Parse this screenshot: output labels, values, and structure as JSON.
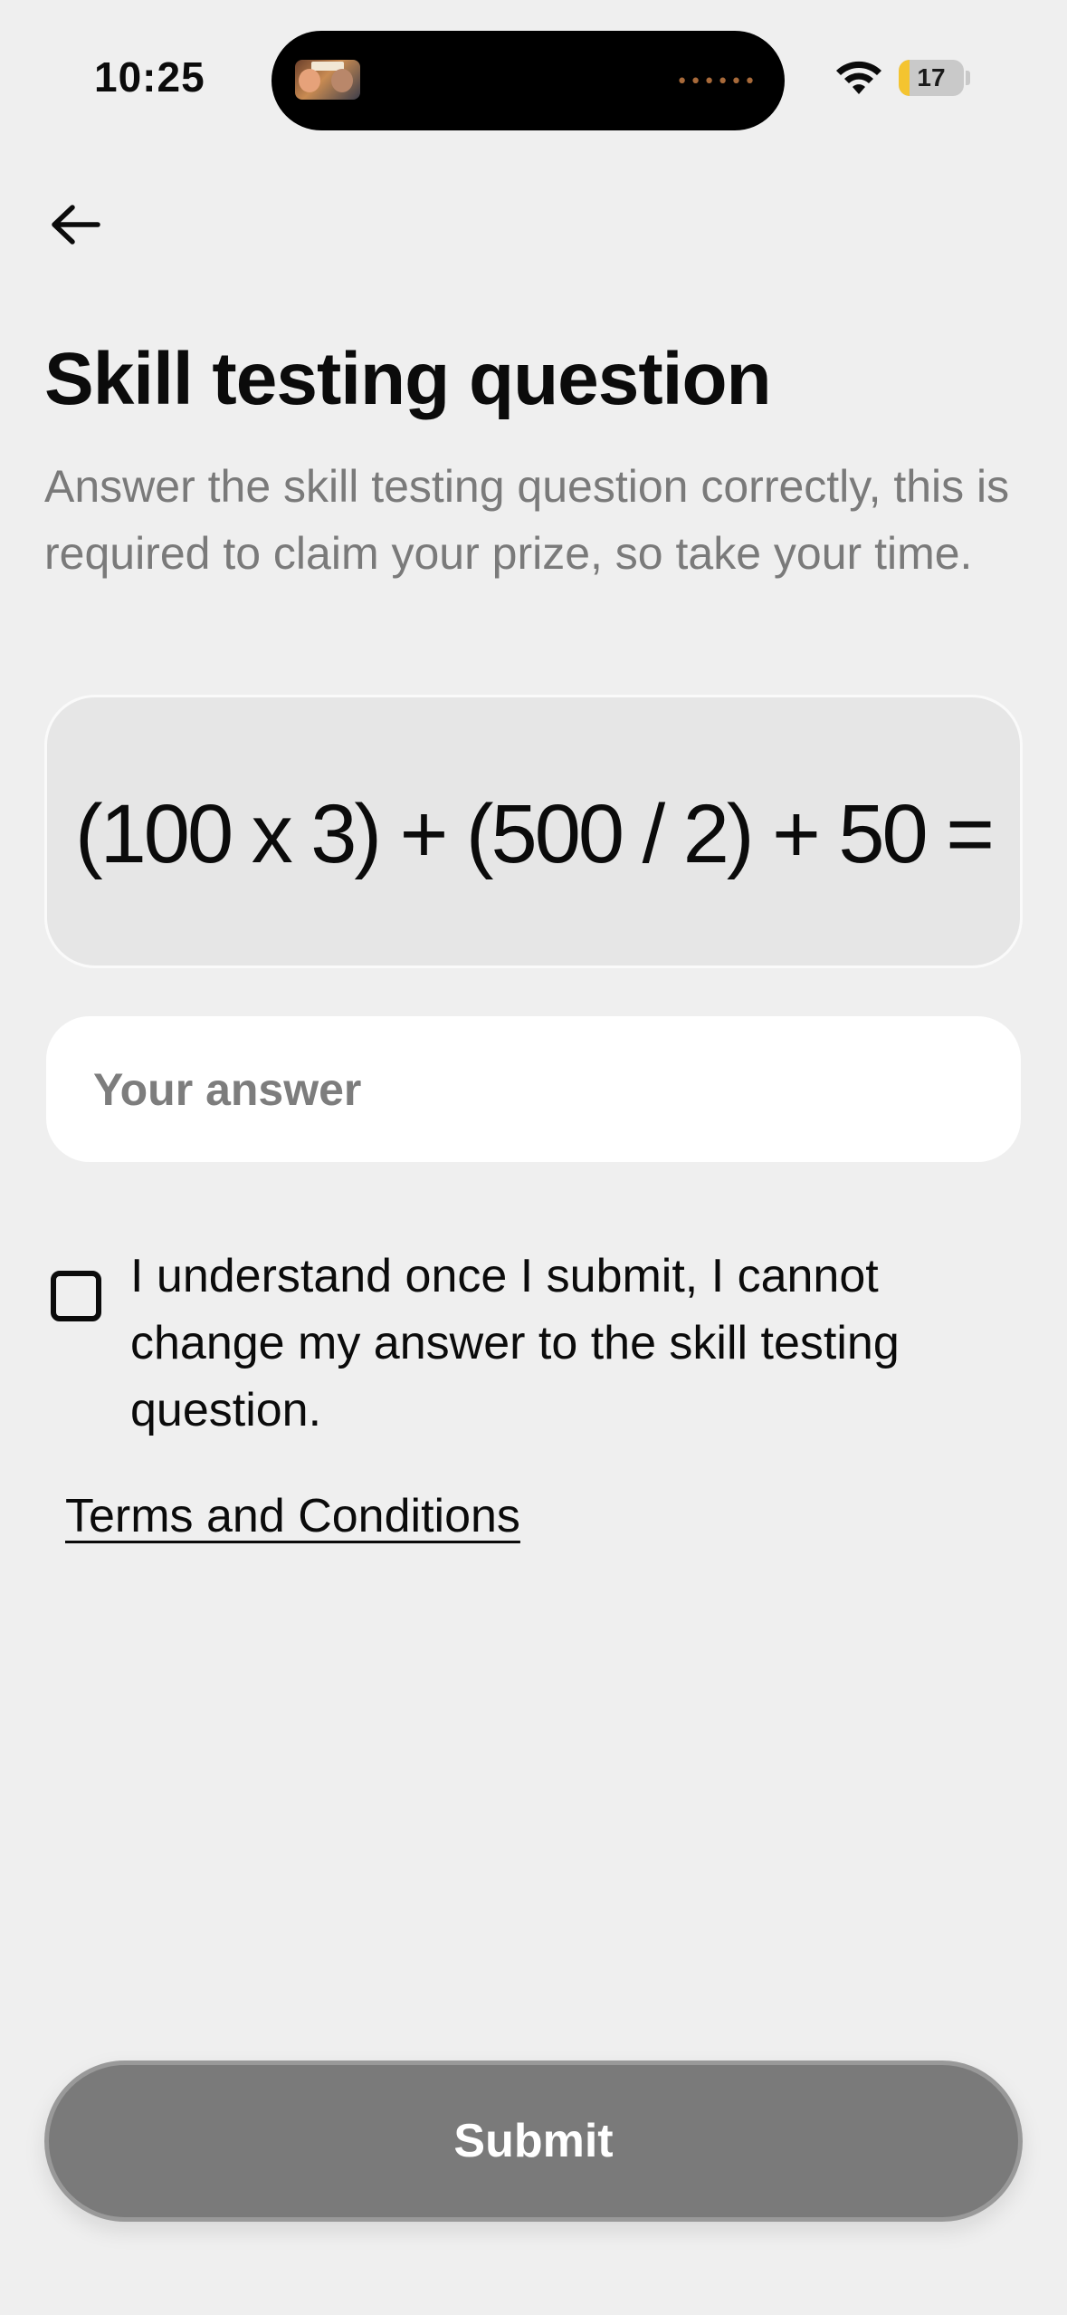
{
  "status_bar": {
    "time": "10:25",
    "battery_level": "17",
    "battery_fraction": 0.17,
    "battery_color": "#f4c430",
    "icons": [
      "wifi-icon",
      "battery-icon"
    ],
    "island_activity_indicator": "••••••"
  },
  "header": {
    "back_icon": "arrow-left-icon"
  },
  "main": {
    "title": "Skill testing question",
    "subtitle": "Answer the skill testing question correctly, this is required to claim your prize, so take your time.",
    "question": "(100 x 3) + (500 / 2) + 50 =",
    "answer_input": {
      "value": "",
      "placeholder": "Your answer"
    },
    "acknowledgement": {
      "checked": false,
      "label": "I understand once I submit, I cannot change my answer to the skill testing question."
    },
    "terms_link": "Terms and Conditions"
  },
  "footer": {
    "submit_label": "Submit",
    "submit_color": "#7a7a7a"
  }
}
